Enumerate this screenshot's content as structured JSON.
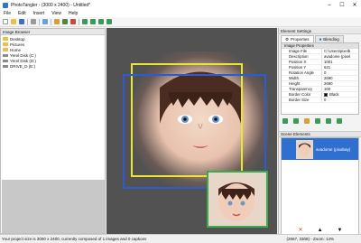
{
  "window": {
    "title": "PhotoTangler - (3000 x 2400) - Untitled*"
  },
  "menu": [
    "File",
    "Edit",
    "Insert",
    "View",
    "Help"
  ],
  "left_panel": {
    "header": "Image Browser",
    "tree": [
      {
        "label": "Desktop",
        "icon": "folder-icon"
      },
      {
        "label": "Pictures",
        "icon": "folder-icon"
      },
      {
        "label": "Home",
        "icon": "folder-icon"
      },
      {
        "label": "Yerel Disk (C:)",
        "icon": "drive-icon"
      },
      {
        "label": "Yerel Disk (D:)",
        "icon": "drive-icon"
      },
      {
        "label": "DRIVE_D (E:)",
        "icon": "drive-icon"
      }
    ]
  },
  "right_panel": {
    "header": "Element Settings",
    "tabs": [
      "Properties",
      "Blending"
    ],
    "prop_category": "Image Properties",
    "props": [
      {
        "name": "Image File",
        "value": "C:\\Users\\pixelb"
      },
      {
        "name": "Description",
        "value": "avadome (pixel"
      },
      {
        "name": "Position X",
        "value": "1001"
      },
      {
        "name": "Position Y",
        "value": "621"
      },
      {
        "name": "Rotation Angle",
        "value": "0"
      },
      {
        "name": "Width",
        "value": "2690"
      },
      {
        "name": "Height",
        "value": "2690"
      },
      {
        "name": "Transparency",
        "value": "100"
      },
      {
        "name": "Border Color",
        "value": "Black"
      },
      {
        "name": "Border Size",
        "value": "0"
      }
    ],
    "scene_header": "Scene Elements",
    "scene_item_label": "avadome (pixabay)"
  },
  "status": {
    "left": "Your project size is 3000 x 2400, currently composed of 1 images and 0 captions",
    "right": "(2667, 3308) - Zoom: 14%"
  },
  "colors": {
    "selection_yellow": "#e8e830",
    "selection_blue": "#2a5cd4",
    "selection_green": "#3ca850",
    "scene_highlight": "#2e6fd0"
  }
}
